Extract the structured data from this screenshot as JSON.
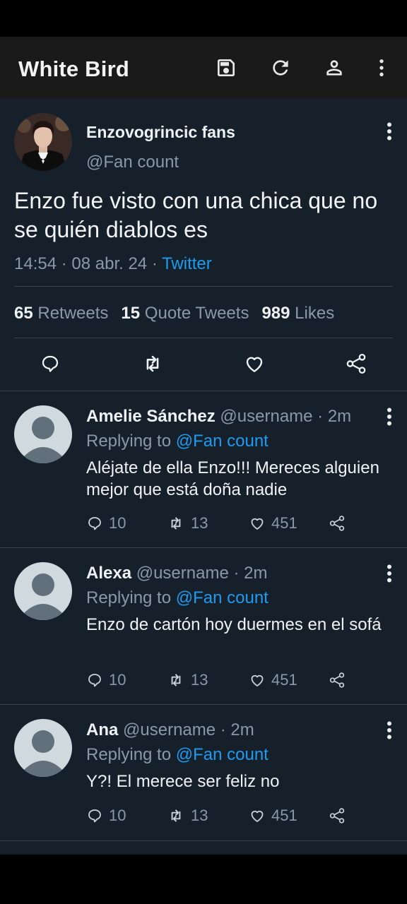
{
  "app": {
    "title": "White Bird"
  },
  "toolbar": {
    "icons": [
      "save-icon",
      "refresh-icon",
      "profile-icon",
      "more-vertical-icon"
    ]
  },
  "tweet": {
    "author_name": "Enzovogrincic fans",
    "author_handle": "@Fan count",
    "text": "Enzo fue visto con una chica que no se quién diablos es",
    "time": "14:54",
    "dot1": " · ",
    "date": "08 abr. 24",
    "dot2": " · ",
    "source": "Twitter",
    "retweets_count": "65",
    "retweets_label": "Retweets",
    "quotes_count": "15",
    "quotes_label": "Quote Tweets",
    "likes_count": "989",
    "likes_label": "Likes"
  },
  "replies": [
    {
      "name": "Amelie Sánchez",
      "meta": "@username · 2m",
      "replying_prefix": "Replying to ",
      "replying_to": "@Fan count",
      "text": "Aléjate de ella Enzo!!! Mereces alguien mejor que está doña nadie",
      "replies": "10",
      "retweets": "13",
      "likes": "451"
    },
    {
      "name": "Alexa",
      "meta": "@username · 2m",
      "replying_prefix": "Replying to ",
      "replying_to": "@Fan count",
      "text": "Enzo de cartón hoy duermes en el sofá",
      "replies": "10",
      "retweets": "13",
      "likes": "451"
    },
    {
      "name": "Ana",
      "meta": "@username · 2m",
      "replying_prefix": "Replying to ",
      "replying_to": "@Fan count",
      "text": "Y?! El merece ser feliz no",
      "replies": "10",
      "retweets": "13",
      "likes": "451"
    }
  ],
  "colors": {
    "background": "#15202b",
    "appbar": "#1a1a1a",
    "accent": "#1d9bf0",
    "secondary_text": "#8b98a5"
  }
}
